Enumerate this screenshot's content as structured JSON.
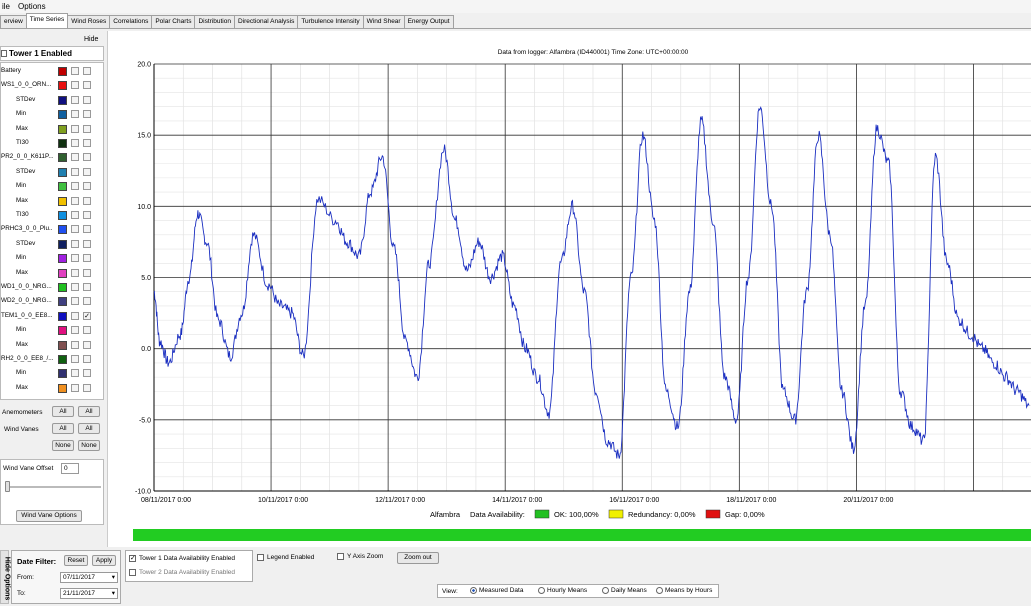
{
  "menu": [
    "ile",
    "Options"
  ],
  "tabs": [
    "erview",
    "Time Series",
    "Wind Roses",
    "Correlations",
    "Polar Charts",
    "Distribution",
    "Directional Analysis",
    "Turbulence Intensity",
    "Wind Shear",
    "Energy Output"
  ],
  "active_tab": 1,
  "left": {
    "hide_label": "Hide",
    "tower_label": "Tower 1 Enabled",
    "sensors": [
      {
        "label": "Battery",
        "color": "#c00000",
        "indent": 0,
        "checked": false
      },
      {
        "label": "WS1_0_0_ORN...",
        "color": "#e81010",
        "indent": 0,
        "checked": false
      },
      {
        "label": "STDev",
        "color": "#101080",
        "indent": 1,
        "checked": false
      },
      {
        "label": "Min",
        "color": "#1060a0",
        "indent": 1,
        "checked": false
      },
      {
        "label": "Max",
        "color": "#80a020",
        "indent": 1,
        "checked": false
      },
      {
        "label": "TI30",
        "color": "#103010",
        "indent": 1,
        "checked": false
      },
      {
        "label": "PR2_0_0_K611P...",
        "color": "#306030",
        "indent": 0,
        "checked": false
      },
      {
        "label": "STDev",
        "color": "#2080b0",
        "indent": 1,
        "checked": false
      },
      {
        "label": "Min",
        "color": "#40c040",
        "indent": 1,
        "checked": false
      },
      {
        "label": "Max",
        "color": "#f0c000",
        "indent": 1,
        "checked": false
      },
      {
        "label": "TI30",
        "color": "#1090e0",
        "indent": 1,
        "checked": false
      },
      {
        "label": "PRHC3_0_0_Plu...",
        "color": "#2050f0",
        "indent": 0,
        "checked": false
      },
      {
        "label": "STDev",
        "color": "#102060",
        "indent": 1,
        "checked": false
      },
      {
        "label": "Min",
        "color": "#a020e0",
        "indent": 1,
        "checked": false
      },
      {
        "label": "Max",
        "color": "#e040c0",
        "indent": 1,
        "checked": false
      },
      {
        "label": "WD1_0_0_NRG...",
        "color": "#20c020",
        "indent": 0,
        "checked": false
      },
      {
        "label": "WD2_0_0_NRG...",
        "color": "#404080",
        "indent": 0,
        "checked": false
      },
      {
        "label": "TEM1_0_0_EE8...",
        "color": "#1010c0",
        "indent": 0,
        "checked": true
      },
      {
        "label": "Min",
        "color": "#e01080",
        "indent": 1,
        "checked": false
      },
      {
        "label": "Max",
        "color": "#805050",
        "indent": 1,
        "checked": false
      },
      {
        "label": "RH2_0_0_EE8_/...",
        "color": "#106010",
        "indent": 0,
        "checked": false
      },
      {
        "label": "Min",
        "color": "#303070",
        "indent": 1,
        "checked": false
      },
      {
        "label": "Max",
        "color": "#f09020",
        "indent": 1,
        "checked": false
      }
    ],
    "anemometers_label": "Anemometers",
    "wind_vanes_label": "Wind Vanes",
    "all_label": "All",
    "none_label": "None",
    "offset_label": "Wind Vane Offset",
    "offset_value": "0",
    "offset_options_label": "Wind Vane Options"
  },
  "chart": {
    "title": "Data from logger: Alfambra (ID440001) Time Zone: UTC+00:00:00",
    "yticks": [
      "20.0",
      "15.0",
      "10.0",
      "5.0",
      "0.0",
      "-5.0",
      "-10.0"
    ],
    "xticks": [
      "08/11/2017 0:00",
      "10/11/2017 0:00",
      "12/11/2017 0:00",
      "14/11/2017 0:00",
      "16/11/2017 0:00",
      "18/11/2017 0:00",
      "20/11/2017 0:00"
    ],
    "line_color": "#1a2ec0",
    "availability": {
      "site": "Alfambra",
      "label": "Data Availability:",
      "ok_label": "OK: 100,00%",
      "redundancy_label": "Redundancy: 0,00%",
      "gap_label": "Gap: 0,00%",
      "ok_color": "#22c022",
      "red_color": "#f0f000",
      "gap_color": "#e01010",
      "bar_color": "#22cc22"
    }
  },
  "chart_data": {
    "type": "line",
    "ylim": [
      -10,
      20
    ],
    "x_range": [
      "06/11/2017 0:00",
      "21/11/2017 0:00"
    ],
    "series": [
      {
        "x_days_from_start": [
          0,
          0.1,
          0.25,
          0.45,
          0.6,
          0.75,
          0.9,
          1.1,
          1.3,
          1.5,
          1.7,
          1.95,
          2.15,
          2.35,
          2.55,
          2.8,
          3.1,
          3.3,
          3.5,
          3.7,
          3.9,
          4.1,
          4.3,
          4.5,
          4.7,
          4.95,
          5.15,
          5.35,
          5.55,
          5.75,
          5.95,
          6.15,
          6.35,
          6.55,
          6.75,
          6.95,
          7.15,
          7.35,
          7.55,
          7.75,
          7.95,
          8.15,
          8.35,
          8.55,
          8.75,
          8.95,
          9.15,
          9.35,
          9.55,
          9.75,
          9.95,
          10.15,
          10.35,
          10.55,
          10.75,
          10.95,
          11.15,
          11.35,
          11.55,
          11.75,
          11.95,
          12.15,
          12.35,
          12.55,
          12.75,
          12.95,
          13.15,
          13.35,
          13.55,
          13.75,
          13.95,
          14.15,
          14.35,
          14.55,
          14.75,
          14.95
        ],
        "y": [
          4.0,
          0.5,
          -1.0,
          1.0,
          5.0,
          9.5,
          7.5,
          2.0,
          -0.5,
          2.5,
          8.0,
          4.5,
          3.0,
          2.5,
          -0.5,
          10.5,
          9.0,
          7.5,
          6.5,
          11.0,
          13.5,
          7.0,
          0.5,
          -2.0,
          6.0,
          14.0,
          9.0,
          5.5,
          7.5,
          5.0,
          6.5,
          3.0,
          0.0,
          -2.0,
          -4.5,
          6.0,
          10.0,
          4.0,
          -3.0,
          -6.5,
          -7.5,
          5.0,
          15.0,
          9.0,
          -3.0,
          -5.5,
          4.0,
          16.0,
          9.0,
          -2.0,
          -5.0,
          5.0,
          17.0,
          10.0,
          -3.0,
          -5.0,
          4.0,
          15.0,
          8.0,
          -3.0,
          -7.0,
          3.0,
          15.5,
          13.0,
          -3.0,
          -5.5,
          -6.5,
          13.5,
          6.0,
          2.0,
          1.0,
          0.0,
          -1.0,
          -2.0,
          -3.0,
          -4.0
        ]
      }
    ]
  },
  "bottom": {
    "hide_options_label": "Hide Options",
    "date_filter_label": "Date Filter:",
    "reset_label": "Reset",
    "apply_label": "Apply",
    "from_label": "From:",
    "from_value": "07/11/2017",
    "to_label": "To:",
    "to_value": "21/11/2017",
    "tower1_avail_label": "Tower 1 Data Availability Enabled",
    "tower2_avail_label": "Tower 2 Data Availability Enabled",
    "legend_label": "Legend Enabled",
    "yaxis_zoom_label": "Y Axis Zoom",
    "zoom_out_label": "Zoom out",
    "view_label": "View:",
    "view_options": [
      "Measured Data",
      "Hourly Means",
      "Daily Means",
      "Means by Hours"
    ],
    "view_selected": 0
  }
}
